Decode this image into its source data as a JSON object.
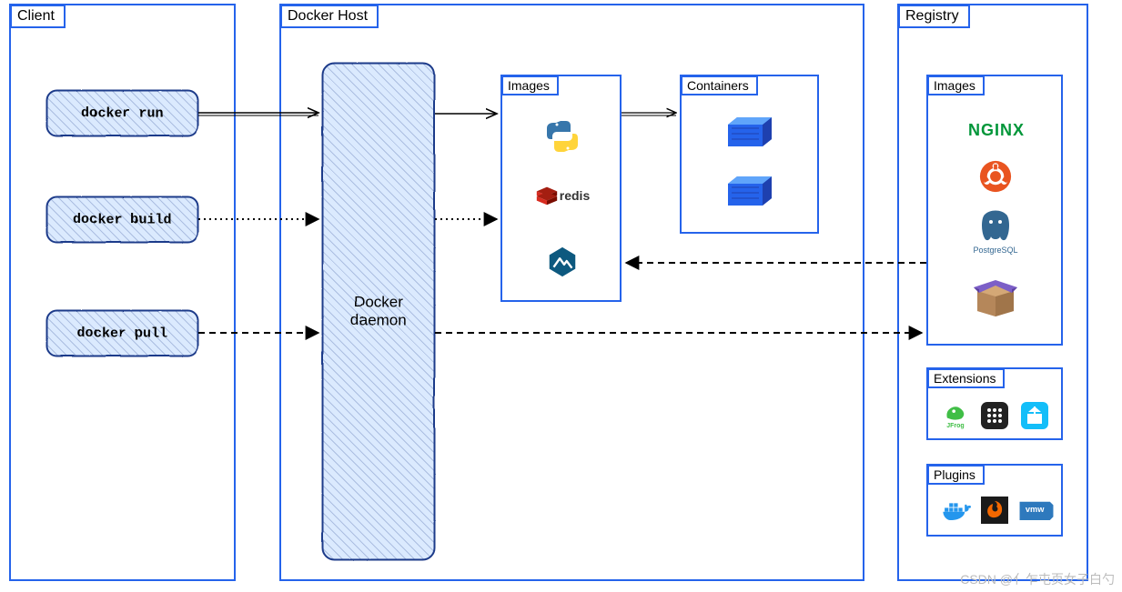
{
  "client": {
    "title": "Client",
    "commands": {
      "run": "docker run",
      "build": "docker build",
      "pull": "docker pull"
    }
  },
  "host": {
    "title": "Docker Host",
    "daemon_label_l1": "Docker",
    "daemon_label_l2": "daemon",
    "images": {
      "title": "Images",
      "items": [
        "python-icon",
        "redis-icon",
        "alpine-icon"
      ]
    },
    "containers": {
      "title": "Containers",
      "items": [
        "container-icon",
        "container-icon"
      ]
    }
  },
  "registry": {
    "title": "Registry",
    "images": {
      "title": "Images",
      "items": [
        "nginx-icon",
        "ubuntu-icon",
        "postgresql-icon",
        "box-icon"
      ]
    },
    "extensions": {
      "title": "Extensions",
      "items": [
        "jfrog-icon",
        "grid-icon",
        "portainer-icon"
      ]
    },
    "plugins": {
      "title": "Plugins",
      "items": [
        "docker-icon",
        "grafana-icon",
        "vmware-icon"
      ]
    }
  },
  "arrows": {
    "run_to_daemon": {
      "style": "solid"
    },
    "build_to_daemon": {
      "style": "dotted"
    },
    "pull_to_daemon": {
      "style": "dashed"
    },
    "daemon_to_images_run": {
      "style": "solid"
    },
    "daemon_to_images_build": {
      "style": "dotted"
    },
    "images_to_containers": {
      "style": "solid"
    },
    "registry_to_images": {
      "style": "dashed"
    },
    "daemon_to_registry": {
      "style": "dashed"
    }
  },
  "labels": {
    "redis": "redis",
    "nginx": "NGINX",
    "postgresql": "PostgreSQL",
    "vmw": "vmw",
    "jfrog": "JFrog"
  },
  "watermark": "CSDN @亻乍屯页女子白勺"
}
